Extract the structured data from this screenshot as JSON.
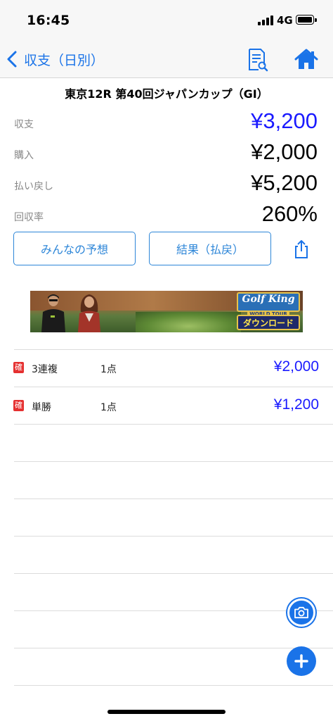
{
  "status_bar": {
    "time": "16:45",
    "network": "4G"
  },
  "nav": {
    "back_label": "収支（日別）"
  },
  "race": {
    "title": "東京12R  第40回ジャパンカップ（GI）"
  },
  "summary": [
    {
      "label": "収支",
      "value": "¥3,200",
      "highlight": true
    },
    {
      "label": "購入",
      "value": "¥2,000",
      "highlight": false
    },
    {
      "label": "払い戻し",
      "value": "¥5,200",
      "highlight": false
    },
    {
      "label": "回収率",
      "value": "260%",
      "highlight": false
    }
  ],
  "buttons": {
    "predictions": "みんなの予想",
    "results": "結果（払戻）"
  },
  "banner": {
    "logo": "Golf King",
    "logo_sub": "WORLD TOUR",
    "cta": "ダウンロード"
  },
  "bets": [
    {
      "badge": "確",
      "type": "3連複",
      "count": "1点",
      "amount": "¥2,000"
    },
    {
      "badge": "確",
      "type": "単勝",
      "count": "1点",
      "amount": "¥1,200"
    }
  ],
  "colors": {
    "accent": "#1a73e8",
    "amount_blue": "#1a1aff",
    "badge_red": "#e53030"
  },
  "icons": [
    "back-chevron-icon",
    "document-search-icon",
    "home-icon",
    "share-icon",
    "camera-icon",
    "plus-icon"
  ]
}
